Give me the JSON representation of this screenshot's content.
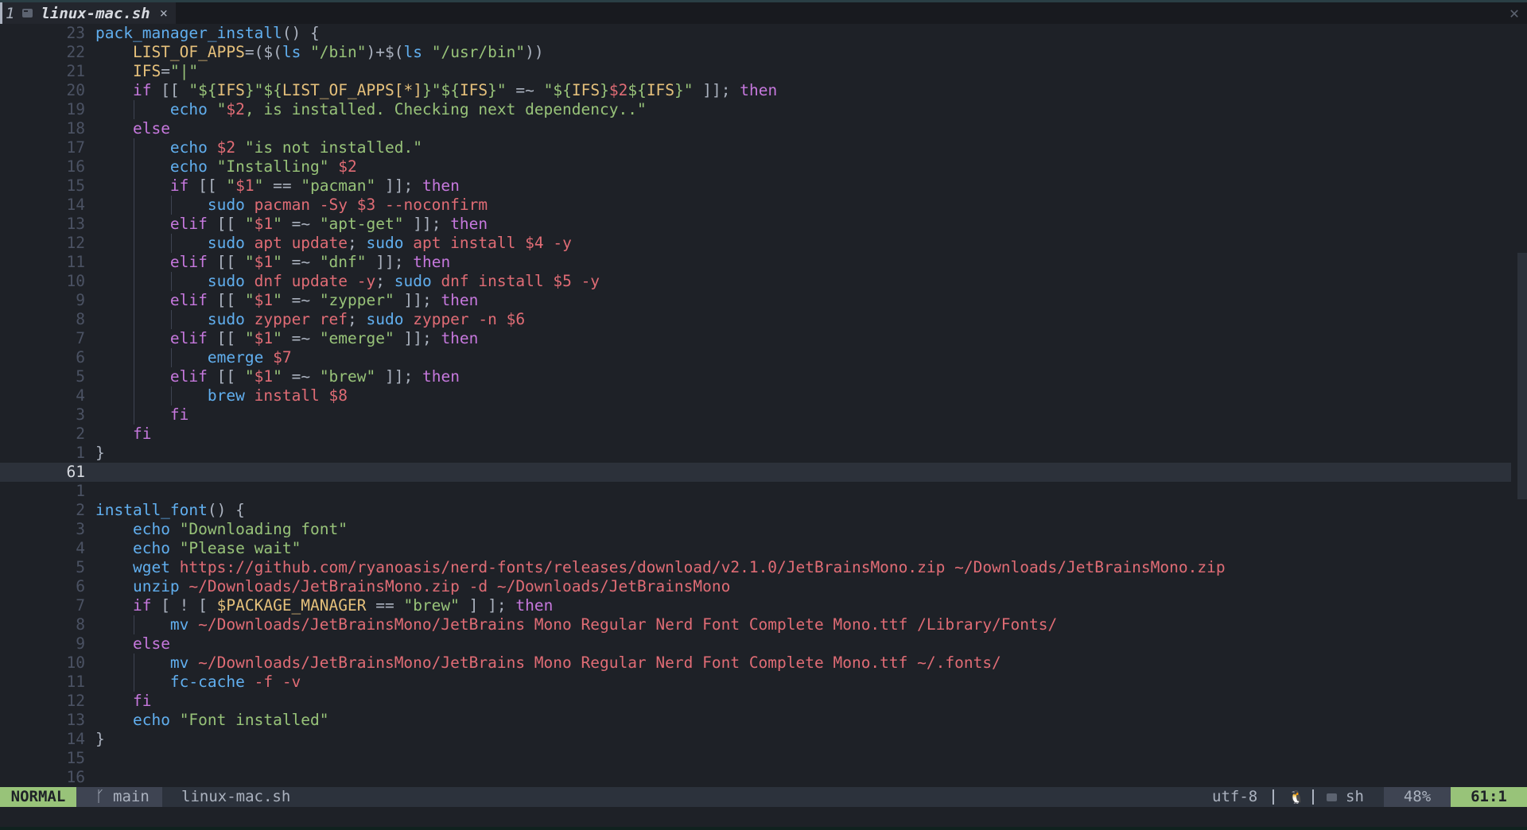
{
  "tabline": {
    "tab_number": "1",
    "tab_file_name": "linux-mac.sh",
    "tab_close_glyph": "×",
    "window_close_glyph": "✕"
  },
  "icons": {
    "file": "terminal-file-icon",
    "branch": "git-branch-icon",
    "os": "linux-penguin-icon"
  },
  "colors": {
    "mode_bg": "#98c379",
    "function": "#61afef",
    "keyword": "#c678dd",
    "string": "#98c379",
    "variable": "#e5c07b",
    "argument": "#e06c75"
  },
  "editor": {
    "lines": [
      {
        "ln": "23",
        "guides": 0,
        "tokens": [
          [
            "fn",
            "pack_manager_install"
          ],
          [
            "pl",
            "() {"
          ]
        ]
      },
      {
        "ln": "22",
        "guides": 0,
        "tokens": [
          [
            "pl",
            "    "
          ],
          [
            "var",
            "LIST_OF_APPS"
          ],
          [
            "pl",
            "=($("
          ],
          [
            "cmd",
            "ls"
          ],
          [
            "pl",
            " "
          ],
          [
            "str",
            "\"/bin\""
          ],
          [
            "pl",
            ")+$("
          ],
          [
            "cmd",
            "ls"
          ],
          [
            "pl",
            " "
          ],
          [
            "str",
            "\"/usr/bin\""
          ],
          [
            "pl",
            "))"
          ]
        ]
      },
      {
        "ln": "21",
        "guides": 0,
        "tokens": [
          [
            "pl",
            "    "
          ],
          [
            "var",
            "IFS"
          ],
          [
            "pl",
            "="
          ],
          [
            "str",
            "\"|\""
          ]
        ]
      },
      {
        "ln": "20",
        "guides": 0,
        "tokens": [
          [
            "pl",
            "    "
          ],
          [
            "kw",
            "if"
          ],
          [
            "pl",
            " [[ "
          ],
          [
            "str",
            "\"${"
          ],
          [
            "var",
            "IFS"
          ],
          [
            "str",
            "}\"${"
          ],
          [
            "var",
            "LIST_OF_APPS[*]"
          ],
          [
            "str",
            "}\"${"
          ],
          [
            "var",
            "IFS"
          ],
          [
            "str",
            "}\""
          ],
          [
            "pl",
            " =~ "
          ],
          [
            "str",
            "\"${"
          ],
          [
            "var",
            "IFS"
          ],
          [
            "str",
            "}"
          ],
          [
            "dol",
            "$2"
          ],
          [
            "str",
            "${"
          ],
          [
            "var",
            "IFS"
          ],
          [
            "str",
            "}\""
          ],
          [
            "pl",
            " ]]; "
          ],
          [
            "kw",
            "then"
          ]
        ]
      },
      {
        "ln": "19",
        "guides": 1,
        "tokens": [
          [
            "pl",
            "        "
          ],
          [
            "cmd",
            "echo"
          ],
          [
            "pl",
            " "
          ],
          [
            "str",
            "\""
          ],
          [
            "dol",
            "$2"
          ],
          [
            "str",
            ", is installed. Checking next dependency..\""
          ]
        ]
      },
      {
        "ln": "18",
        "guides": 0,
        "tokens": [
          [
            "pl",
            "    "
          ],
          [
            "kw",
            "else"
          ]
        ]
      },
      {
        "ln": "17",
        "guides": 1,
        "tokens": [
          [
            "pl",
            "        "
          ],
          [
            "cmd",
            "echo"
          ],
          [
            "pl",
            " "
          ],
          [
            "dol",
            "$2"
          ],
          [
            "pl",
            " "
          ],
          [
            "str",
            "\"is not installed.\""
          ]
        ]
      },
      {
        "ln": "16",
        "guides": 1,
        "tokens": [
          [
            "pl",
            "        "
          ],
          [
            "cmd",
            "echo"
          ],
          [
            "pl",
            " "
          ],
          [
            "str",
            "\"Installing\""
          ],
          [
            "pl",
            " "
          ],
          [
            "dol",
            "$2"
          ]
        ]
      },
      {
        "ln": "15",
        "guides": 1,
        "tokens": [
          [
            "pl",
            "        "
          ],
          [
            "kw",
            "if"
          ],
          [
            "pl",
            " [[ "
          ],
          [
            "str",
            "\""
          ],
          [
            "dol",
            "$1"
          ],
          [
            "str",
            "\""
          ],
          [
            "pl",
            " == "
          ],
          [
            "str",
            "\"pacman\""
          ],
          [
            "pl",
            " ]]; "
          ],
          [
            "kw",
            "then"
          ]
        ]
      },
      {
        "ln": "14",
        "guides": 2,
        "tokens": [
          [
            "pl",
            "            "
          ],
          [
            "cmd",
            "sudo"
          ],
          [
            "pl",
            " "
          ],
          [
            "arg",
            "pacman -Sy "
          ],
          [
            "dol",
            "$3"
          ],
          [
            "pl",
            " "
          ],
          [
            "arg",
            "--noconfirm"
          ]
        ]
      },
      {
        "ln": "13",
        "guides": 1,
        "tokens": [
          [
            "pl",
            "        "
          ],
          [
            "kw",
            "elif"
          ],
          [
            "pl",
            " [[ "
          ],
          [
            "str",
            "\""
          ],
          [
            "dol",
            "$1"
          ],
          [
            "str",
            "\""
          ],
          [
            "pl",
            " =~ "
          ],
          [
            "str",
            "\"apt-get\""
          ],
          [
            "pl",
            " ]]; "
          ],
          [
            "kw",
            "then"
          ]
        ]
      },
      {
        "ln": "12",
        "guides": 2,
        "tokens": [
          [
            "pl",
            "            "
          ],
          [
            "cmd",
            "sudo"
          ],
          [
            "pl",
            " "
          ],
          [
            "arg",
            "apt update"
          ],
          [
            "pl",
            "; "
          ],
          [
            "cmd",
            "sudo"
          ],
          [
            "pl",
            " "
          ],
          [
            "arg",
            "apt install "
          ],
          [
            "dol",
            "$4"
          ],
          [
            "pl",
            " "
          ],
          [
            "arg",
            "-y"
          ]
        ]
      },
      {
        "ln": "11",
        "guides": 1,
        "tokens": [
          [
            "pl",
            "        "
          ],
          [
            "kw",
            "elif"
          ],
          [
            "pl",
            " [[ "
          ],
          [
            "str",
            "\""
          ],
          [
            "dol",
            "$1"
          ],
          [
            "str",
            "\""
          ],
          [
            "pl",
            " =~ "
          ],
          [
            "str",
            "\"dnf\""
          ],
          [
            "pl",
            " ]]; "
          ],
          [
            "kw",
            "then"
          ]
        ]
      },
      {
        "ln": "10",
        "guides": 2,
        "tokens": [
          [
            "pl",
            "            "
          ],
          [
            "cmd",
            "sudo"
          ],
          [
            "pl",
            " "
          ],
          [
            "arg",
            "dnf update -y"
          ],
          [
            "pl",
            "; "
          ],
          [
            "cmd",
            "sudo"
          ],
          [
            "pl",
            " "
          ],
          [
            "arg",
            "dnf install "
          ],
          [
            "dol",
            "$5"
          ],
          [
            "pl",
            " "
          ],
          [
            "arg",
            "-y"
          ]
        ]
      },
      {
        "ln": "9",
        "guides": 1,
        "tokens": [
          [
            "pl",
            "        "
          ],
          [
            "kw",
            "elif"
          ],
          [
            "pl",
            " [[ "
          ],
          [
            "str",
            "\""
          ],
          [
            "dol",
            "$1"
          ],
          [
            "str",
            "\""
          ],
          [
            "pl",
            " =~ "
          ],
          [
            "str",
            "\"zypper\""
          ],
          [
            "pl",
            " ]]; "
          ],
          [
            "kw",
            "then"
          ]
        ]
      },
      {
        "ln": "8",
        "guides": 2,
        "tokens": [
          [
            "pl",
            "            "
          ],
          [
            "cmd",
            "sudo"
          ],
          [
            "pl",
            " "
          ],
          [
            "arg",
            "zypper ref"
          ],
          [
            "pl",
            "; "
          ],
          [
            "cmd",
            "sudo"
          ],
          [
            "pl",
            " "
          ],
          [
            "arg",
            "zypper -n "
          ],
          [
            "dol",
            "$6"
          ]
        ]
      },
      {
        "ln": "7",
        "guides": 1,
        "tokens": [
          [
            "pl",
            "        "
          ],
          [
            "kw",
            "elif"
          ],
          [
            "pl",
            " [[ "
          ],
          [
            "str",
            "\""
          ],
          [
            "dol",
            "$1"
          ],
          [
            "str",
            "\""
          ],
          [
            "pl",
            " =~ "
          ],
          [
            "str",
            "\"emerge\""
          ],
          [
            "pl",
            " ]]; "
          ],
          [
            "kw",
            "then"
          ]
        ]
      },
      {
        "ln": "6",
        "guides": 2,
        "tokens": [
          [
            "pl",
            "            "
          ],
          [
            "cmd",
            "emerge"
          ],
          [
            "pl",
            " "
          ],
          [
            "dol",
            "$7"
          ]
        ]
      },
      {
        "ln": "5",
        "guides": 1,
        "tokens": [
          [
            "pl",
            "        "
          ],
          [
            "kw",
            "elif"
          ],
          [
            "pl",
            " [[ "
          ],
          [
            "str",
            "\""
          ],
          [
            "dol",
            "$1"
          ],
          [
            "str",
            "\""
          ],
          [
            "pl",
            " =~ "
          ],
          [
            "str",
            "\"brew\""
          ],
          [
            "pl",
            " ]]; "
          ],
          [
            "kw",
            "then"
          ]
        ]
      },
      {
        "ln": "4",
        "guides": 2,
        "tokens": [
          [
            "pl",
            "            "
          ],
          [
            "cmd",
            "brew"
          ],
          [
            "pl",
            " "
          ],
          [
            "arg",
            "install "
          ],
          [
            "dol",
            "$8"
          ]
        ]
      },
      {
        "ln": "3",
        "guides": 1,
        "tokens": [
          [
            "pl",
            "        "
          ],
          [
            "kw",
            "fi"
          ]
        ]
      },
      {
        "ln": "2",
        "guides": 0,
        "tokens": [
          [
            "pl",
            "    "
          ],
          [
            "kw",
            "fi"
          ]
        ]
      },
      {
        "ln": "1",
        "guides": 0,
        "tokens": [
          [
            "pl",
            "}"
          ]
        ]
      },
      {
        "ln": "61",
        "guides": 0,
        "current": true,
        "tokens": []
      },
      {
        "ln": "1",
        "guides": 0,
        "tokens": []
      },
      {
        "ln": "2",
        "guides": 0,
        "tokens": [
          [
            "fn",
            "install_font"
          ],
          [
            "pl",
            "() {"
          ]
        ]
      },
      {
        "ln": "3",
        "guides": 0,
        "tokens": [
          [
            "pl",
            "    "
          ],
          [
            "cmd",
            "echo"
          ],
          [
            "pl",
            " "
          ],
          [
            "str",
            "\"Downloading font\""
          ]
        ]
      },
      {
        "ln": "4",
        "guides": 0,
        "tokens": [
          [
            "pl",
            "    "
          ],
          [
            "cmd",
            "echo"
          ],
          [
            "pl",
            " "
          ],
          [
            "str",
            "\"Please wait\""
          ]
        ]
      },
      {
        "ln": "5",
        "guides": 0,
        "tokens": [
          [
            "pl",
            "    "
          ],
          [
            "cmd",
            "wget"
          ],
          [
            "pl",
            " "
          ],
          [
            "path",
            "https://github.com/ryanoasis/nerd-fonts/releases/download/v2.1.0/JetBrainsMono.zip ~/Downloads/JetBrainsMono.zip"
          ]
        ]
      },
      {
        "ln": "6",
        "guides": 0,
        "tokens": [
          [
            "pl",
            "    "
          ],
          [
            "cmd",
            "unzip"
          ],
          [
            "pl",
            " "
          ],
          [
            "path",
            "~/Downloads/JetBrainsMono.zip -d ~/Downloads/JetBrainsMono"
          ]
        ]
      },
      {
        "ln": "7",
        "guides": 0,
        "tokens": [
          [
            "pl",
            "    "
          ],
          [
            "kw",
            "if"
          ],
          [
            "pl",
            " [ ! [ "
          ],
          [
            "var",
            "$PACKAGE_MANAGER"
          ],
          [
            "pl",
            " == "
          ],
          [
            "str",
            "\"brew\""
          ],
          [
            "pl",
            " ] ]; "
          ],
          [
            "kw",
            "then"
          ]
        ]
      },
      {
        "ln": "8",
        "guides": 1,
        "tokens": [
          [
            "pl",
            "        "
          ],
          [
            "cmd",
            "mv"
          ],
          [
            "pl",
            " "
          ],
          [
            "path",
            "~/Downloads/JetBrainsMono/JetBrains Mono Regular Nerd Font Complete Mono.ttf /Library/Fonts/"
          ]
        ]
      },
      {
        "ln": "9",
        "guides": 0,
        "tokens": [
          [
            "pl",
            "    "
          ],
          [
            "kw",
            "else"
          ]
        ]
      },
      {
        "ln": "10",
        "guides": 1,
        "tokens": [
          [
            "pl",
            "        "
          ],
          [
            "cmd",
            "mv"
          ],
          [
            "pl",
            " "
          ],
          [
            "path",
            "~/Downloads/JetBrainsMono/JetBrains Mono Regular Nerd Font Complete Mono.ttf ~/.fonts/"
          ]
        ]
      },
      {
        "ln": "11",
        "guides": 1,
        "tokens": [
          [
            "pl",
            "        "
          ],
          [
            "cmd",
            "fc-cache"
          ],
          [
            "pl",
            " "
          ],
          [
            "arg",
            "-f -v"
          ]
        ]
      },
      {
        "ln": "12",
        "guides": 0,
        "tokens": [
          [
            "pl",
            "    "
          ],
          [
            "kw",
            "fi"
          ]
        ]
      },
      {
        "ln": "13",
        "guides": 0,
        "tokens": [
          [
            "pl",
            "    "
          ],
          [
            "cmd",
            "echo"
          ],
          [
            "pl",
            " "
          ],
          [
            "str",
            "\"Font installed\""
          ]
        ]
      },
      {
        "ln": "14",
        "guides": 0,
        "tokens": [
          [
            "pl",
            "}"
          ]
        ]
      },
      {
        "ln": "15",
        "guides": 0,
        "tokens": []
      },
      {
        "ln": "16",
        "guides": 0,
        "tokens": []
      }
    ]
  },
  "statusline": {
    "mode": "NORMAL",
    "branch_glyph": "ᚴ",
    "branch": "main",
    "file_name": "linux-mac.sh",
    "encoding": "utf-8",
    "os_glyph": "🐧",
    "filetype": "sh",
    "percent": "48%",
    "position": "61:1"
  }
}
